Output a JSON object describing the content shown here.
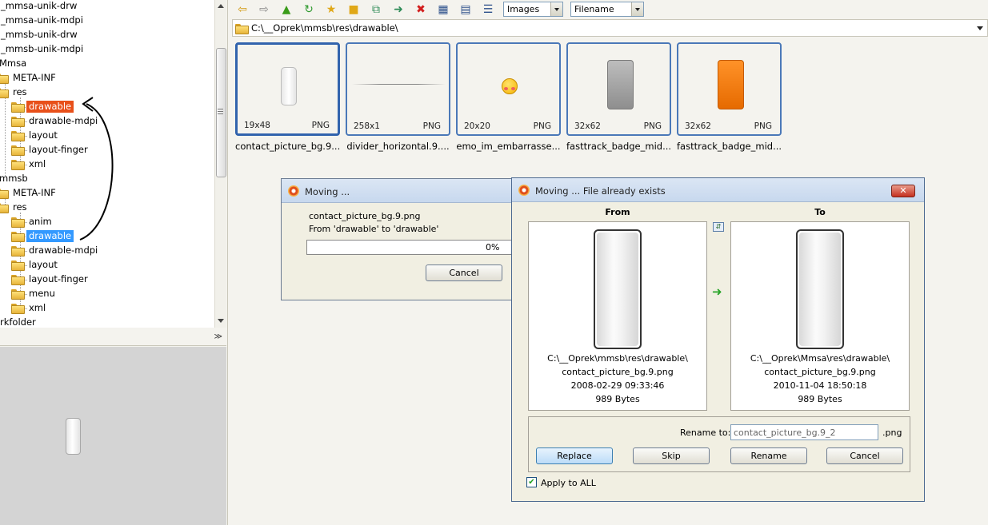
{
  "tree": {
    "nodes": [
      {
        "label": "_mmsa-unik-drw"
      },
      {
        "label": "_mmsa-unik-mdpi"
      },
      {
        "label": "_mmsb-unik-drw"
      },
      {
        "label": "_mmsb-unik-mdpi"
      },
      {
        "label": "Mmsa"
      },
      {
        "label": "META-INF"
      },
      {
        "label": "res"
      },
      {
        "label": "drawable"
      },
      {
        "label": "drawable-mdpi"
      },
      {
        "label": "layout"
      },
      {
        "label": "layout-finger"
      },
      {
        "label": "xml"
      },
      {
        "label": "mmsb"
      },
      {
        "label": "META-INF"
      },
      {
        "label": "res"
      },
      {
        "label": "anim"
      },
      {
        "label": "drawable"
      },
      {
        "label": "drawable-mdpi"
      },
      {
        "label": "layout"
      },
      {
        "label": "layout-finger"
      },
      {
        "label": "menu"
      },
      {
        "label": "xml"
      },
      {
        "label": "rkfolder"
      }
    ]
  },
  "toolbar": {
    "filter_combo": "Images",
    "sort_combo": "Filename"
  },
  "path": {
    "value": "C:\\__Oprek\\mmsb\\res\\drawable\\"
  },
  "thumbnails": [
    {
      "dims": "19x48",
      "format": "PNG",
      "caption": "contact_picture_bg.9..."
    },
    {
      "dims": "258x1",
      "format": "PNG",
      "caption": "divider_horizontal.9...."
    },
    {
      "dims": "20x20",
      "format": "PNG",
      "caption": "emo_im_embarrasse..."
    },
    {
      "dims": "32x62",
      "format": "PNG",
      "caption": "fasttrack_badge_mid..."
    },
    {
      "dims": "32x62",
      "format": "PNG",
      "caption": "fasttrack_badge_mid..."
    }
  ],
  "moving_dialog": {
    "title": "Moving ...",
    "file": "contact_picture_bg.9.png",
    "detail": "From 'drawable' to 'drawable'",
    "progress_text": "0%",
    "progress": 0,
    "cancel": "Cancel"
  },
  "exists_dialog": {
    "title": "Moving ...   File already exists",
    "from_label": "From",
    "to_label": "To",
    "from": {
      "path": "C:\\__Oprek\\mmsb\\res\\drawable\\",
      "name": "contact_picture_bg.9.png",
      "date": "2008-02-29 09:33:46",
      "size": "989 Bytes"
    },
    "to": {
      "path": "C:\\__Oprek\\Mmsa\\res\\drawable\\",
      "name": "contact_picture_bg.9.png",
      "date": "2010-11-04 18:50:18",
      "size": "989 Bytes"
    },
    "rename_label": "Rename to:",
    "rename_value": "contact_picture_bg.9_2",
    "ext": ".png",
    "buttons": {
      "replace": "Replace",
      "skip": "Skip",
      "rename": "Rename",
      "cancel": "Cancel"
    },
    "apply_all": "Apply to ALL",
    "apply_all_checked": true
  }
}
